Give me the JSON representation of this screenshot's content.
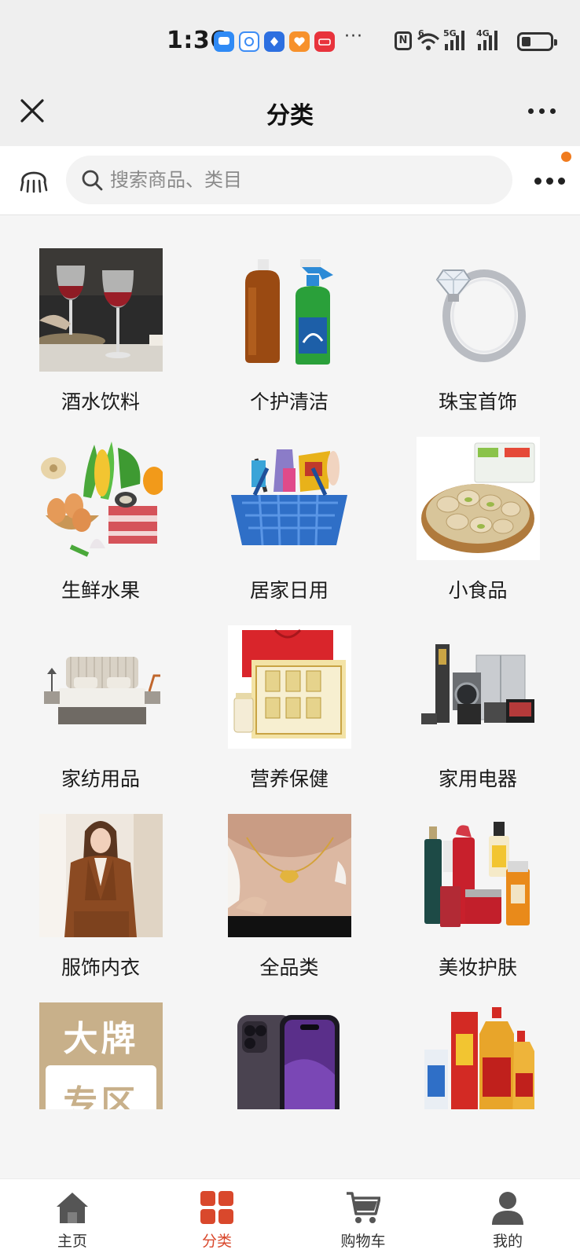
{
  "status_bar": {
    "time": "1:36",
    "app_icons": [
      "message-app-icon",
      "chat-bubble-app-icon",
      "browser-app-icon",
      "heart-app-icon",
      "shop-app-icon"
    ],
    "notification_more": "···",
    "network_5g": "5G",
    "network_4g": "4G",
    "wifi_badge": "6",
    "nfc_label": "N"
  },
  "header": {
    "title": "分类",
    "close_icon": "close-icon",
    "more_icon": "more-dots-icon"
  },
  "search": {
    "placeholder": "搜索商品、类目",
    "value": ""
  },
  "categories": [
    {
      "label": "酒水饮料"
    },
    {
      "label": "个护清洁"
    },
    {
      "label": "珠宝首饰"
    },
    {
      "label": "生鲜水果"
    },
    {
      "label": "居家日用"
    },
    {
      "label": "小食品"
    },
    {
      "label": "家纺用品"
    },
    {
      "label": "营养保健"
    },
    {
      "label": "家用电器"
    },
    {
      "label": "服饰内衣"
    },
    {
      "label": "全品类"
    },
    {
      "label": "美妆护肤"
    },
    {
      "label": ""
    },
    {
      "label": ""
    },
    {
      "label": ""
    }
  ],
  "brand_banner": {
    "line1": "大牌",
    "line2": "专区"
  },
  "tabbar": {
    "items": [
      {
        "label": "主页",
        "icon": "home-icon",
        "active": false
      },
      {
        "label": "分类",
        "icon": "category-grid-icon",
        "active": true
      },
      {
        "label": "购物车",
        "icon": "cart-icon",
        "active": false
      },
      {
        "label": "我的",
        "icon": "user-icon",
        "active": false
      }
    ]
  },
  "colors": {
    "accent": "#d9482c",
    "badge_dot": "#f07b1e",
    "background": "#f5f5f5"
  }
}
